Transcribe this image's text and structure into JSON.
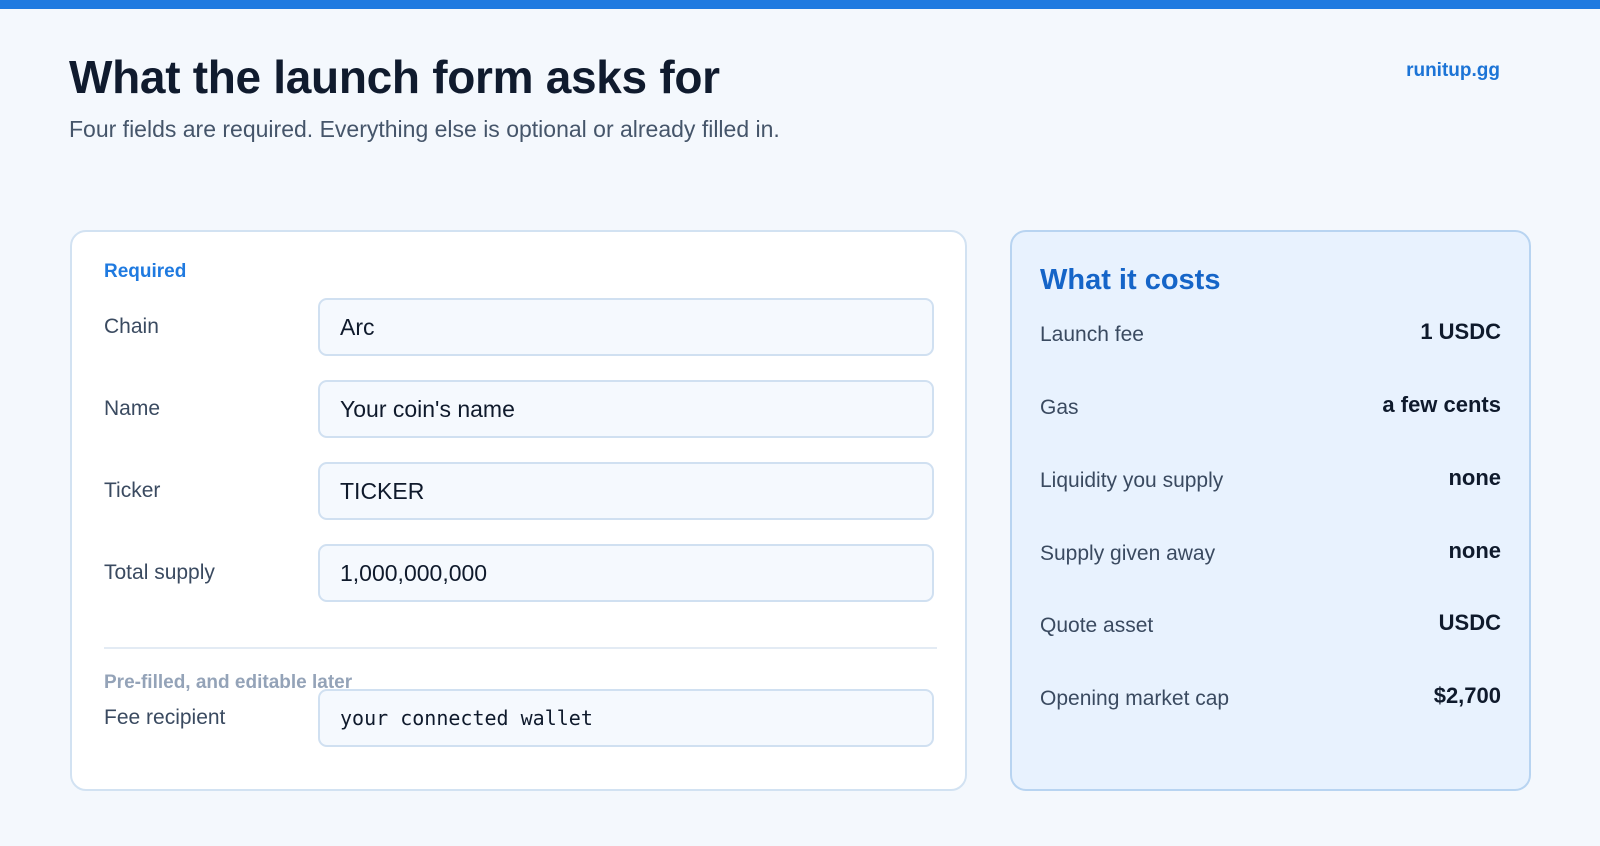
{
  "header": {
    "title": "What the launch form asks for",
    "subtitle": "Four fields are required. Everything else is optional or already filled in.",
    "site_link": "runitup.gg"
  },
  "form": {
    "required_label": "Required",
    "fields": [
      {
        "label": "Chain",
        "value": "Arc"
      },
      {
        "label": "Name",
        "value": "Your coin's name"
      },
      {
        "label": "Ticker",
        "value": "TICKER"
      },
      {
        "label": "Total supply",
        "value": "1,000,000,000"
      }
    ],
    "prefilled_label": "Pre-filled, and editable later",
    "prefilled_fields": [
      {
        "label": "Fee recipient",
        "value": "your connected wallet"
      }
    ]
  },
  "costs": {
    "title": "What it costs",
    "rows": [
      {
        "label": "Launch fee",
        "value": "1 USDC"
      },
      {
        "label": "Gas",
        "value": "a few cents"
      },
      {
        "label": "Liquidity you supply",
        "value": "none"
      },
      {
        "label": "Supply given away",
        "value": "none"
      },
      {
        "label": "Quote asset",
        "value": "USDC"
      },
      {
        "label": "Opening market cap",
        "value": "$2,700"
      }
    ]
  },
  "colors": {
    "accent": "#1f7ae0",
    "page_background": "#f4f8fd",
    "cost_card_background": "#e8f2fe"
  }
}
